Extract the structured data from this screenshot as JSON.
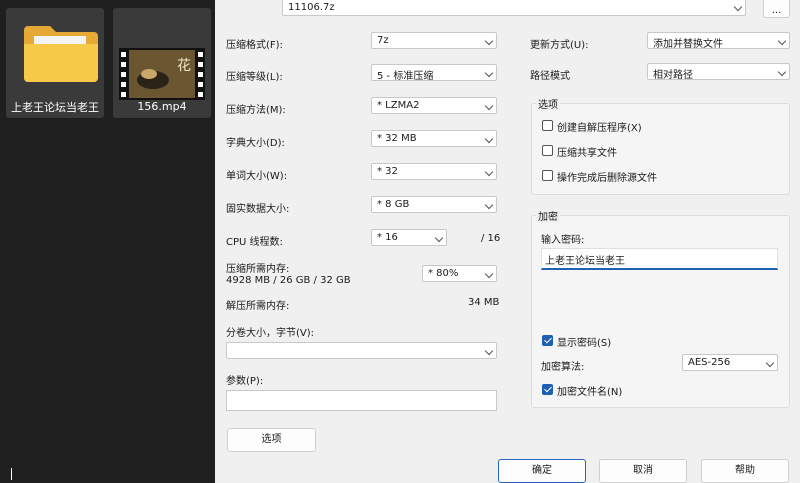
{
  "explorer": {
    "items": [
      {
        "label": "上老王论坛当老王",
        "icon": "folder-icon"
      },
      {
        "label": "156.mp4",
        "icon": "video-thumbnail"
      }
    ],
    "thumb_text": "花"
  },
  "archive": {
    "path": "11106.7z",
    "browse_label": "...",
    "format_label": "压缩格式(F):",
    "format_value": "7z",
    "level_label": "压缩等级(L):",
    "level_value": "5 - 标准压缩",
    "method_label": "压缩方法(M):",
    "method_value": "* LZMA2",
    "dict_label": "字典大小(D):",
    "dict_value": "* 32 MB",
    "word_label": "单词大小(W):",
    "word_value": "* 32",
    "solid_label": "固实数据大小:",
    "solid_value": "* 8 GB",
    "cpu_label": "CPU 线程数:",
    "cpu_value": "* 16",
    "cpu_total": "/ 16",
    "mem_label": "压缩所需内存:",
    "mem_detail": "4928 MB / 26 GB / 32 GB",
    "mem_value": "* 80%",
    "decomp_label": "解压所需内存:",
    "decomp_value": "34 MB",
    "volume_label": "分卷大小，字节(V):",
    "volume_value": "",
    "params_label": "参数(P):",
    "params_value": "",
    "options_button": "选项"
  },
  "update": {
    "mode_label": "更新方式(U):",
    "mode_value": "添加并替换文件",
    "path_label": "路径模式",
    "path_value": "相对路径"
  },
  "options": {
    "title": "选项",
    "sfx": {
      "label": "创建自解压程序(X)",
      "checked": false
    },
    "shared": {
      "label": "压缩共享文件",
      "checked": false
    },
    "delete": {
      "label": "操作完成后删除源文件",
      "checked": false
    }
  },
  "encryption": {
    "title": "加密",
    "password_label": "输入密码:",
    "password_value": "上老王论坛当老王",
    "show_password": {
      "label": "显示密码(S)",
      "checked": true
    },
    "method_label": "加密算法:",
    "method_value": "AES-256",
    "encrypt_names": {
      "label": "加密文件名(N)",
      "checked": true
    }
  },
  "buttons": {
    "ok": "确定",
    "cancel": "取消",
    "help": "帮助"
  },
  "colors": {
    "explorer_bg": "#1f1f1f",
    "dialog_bg": "#f0f0f0",
    "accent": "#1f5fb4"
  }
}
